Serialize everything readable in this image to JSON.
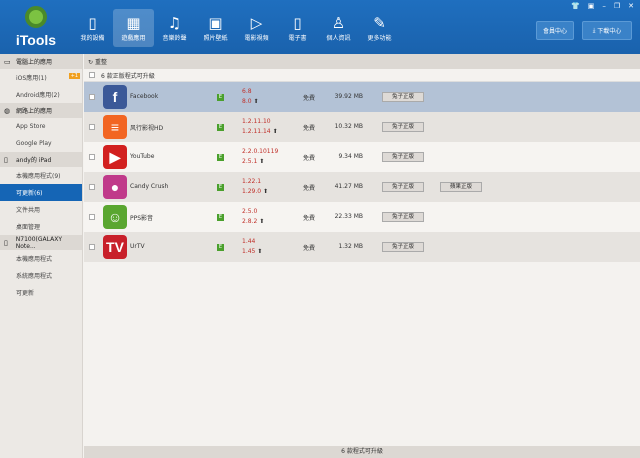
{
  "app": {
    "name": "iTools"
  },
  "nav": [
    {
      "label": "我的設備",
      "icon": "▯"
    },
    {
      "label": "遊戲應用",
      "icon": "▦"
    },
    {
      "label": "音樂鈴聲",
      "icon": "♫"
    },
    {
      "label": "照片壁紙",
      "icon": "▣"
    },
    {
      "label": "電影視頻",
      "icon": "▷"
    },
    {
      "label": "電子書",
      "icon": "▯"
    },
    {
      "label": "個人資訊",
      "icon": "♙"
    },
    {
      "label": "更多功能",
      "icon": "✎"
    }
  ],
  "header": {
    "member": "會員中心",
    "download": "下載中心"
  },
  "sidebar": {
    "pc": "電腦上的應用",
    "ios": "iOS應用(1)",
    "ios_badge": "+1",
    "android": "Android應用(2)",
    "web": "網路上的應用",
    "appstore": "App Store",
    "gplay": "Google Play",
    "ipad": "andy的 iPad",
    "ipad_local": "本機應用程式(9)",
    "ipad_update": "可更新(6)",
    "ipad_files": "文件共用",
    "ipad_desktop": "桌面管理",
    "note": "N7100(GALAXY Note...",
    "note_local": "本機應用程式",
    "note_system": "系統應用程式",
    "note_update": "可更新"
  },
  "toolbar": {
    "refresh": "重整"
  },
  "list": {
    "header": "6 款正版程式可升級",
    "apps": [
      {
        "name": "Facebook",
        "v1": "6.8",
        "v2": "8.0",
        "price": "免費",
        "size": "39.92 MB",
        "btn": "兔子正版",
        "color": "#3b5998",
        "glyph": "f"
      },
      {
        "name": "风行影视HD",
        "v1": "1.2.11.10",
        "v2": "1.2.11.14",
        "price": "免費",
        "size": "10.32 MB",
        "btn": "兔子正版",
        "color": "#f26522",
        "glyph": "≡"
      },
      {
        "name": "YouTube",
        "v1": "2.2.0.10119",
        "v2": "2.5.1",
        "price": "免費",
        "size": "9.34 MB",
        "btn": "兔子正版",
        "color": "#d2201f",
        "glyph": "▶"
      },
      {
        "name": "Candy Crush",
        "v1": "1.22.1",
        "v2": "1.29.0",
        "price": "免費",
        "size": "41.27 MB",
        "btn": "兔子正版",
        "btn2": "蘋果正版",
        "color": "#c03a8a",
        "glyph": "●"
      },
      {
        "name": "PPS影音",
        "v1": "2.5.0",
        "v2": "2.8.2",
        "price": "免費",
        "size": "22.33 MB",
        "btn": "兔子正版",
        "color": "#5aa630",
        "glyph": "☺"
      },
      {
        "name": "UrTV",
        "v1": "1.44",
        "v2": "1.45",
        "price": "免費",
        "size": "1.32 MB",
        "btn": "兔子正版",
        "color": "#c8202a",
        "glyph": "TV"
      }
    ]
  },
  "footer": "6 款程式可升級"
}
